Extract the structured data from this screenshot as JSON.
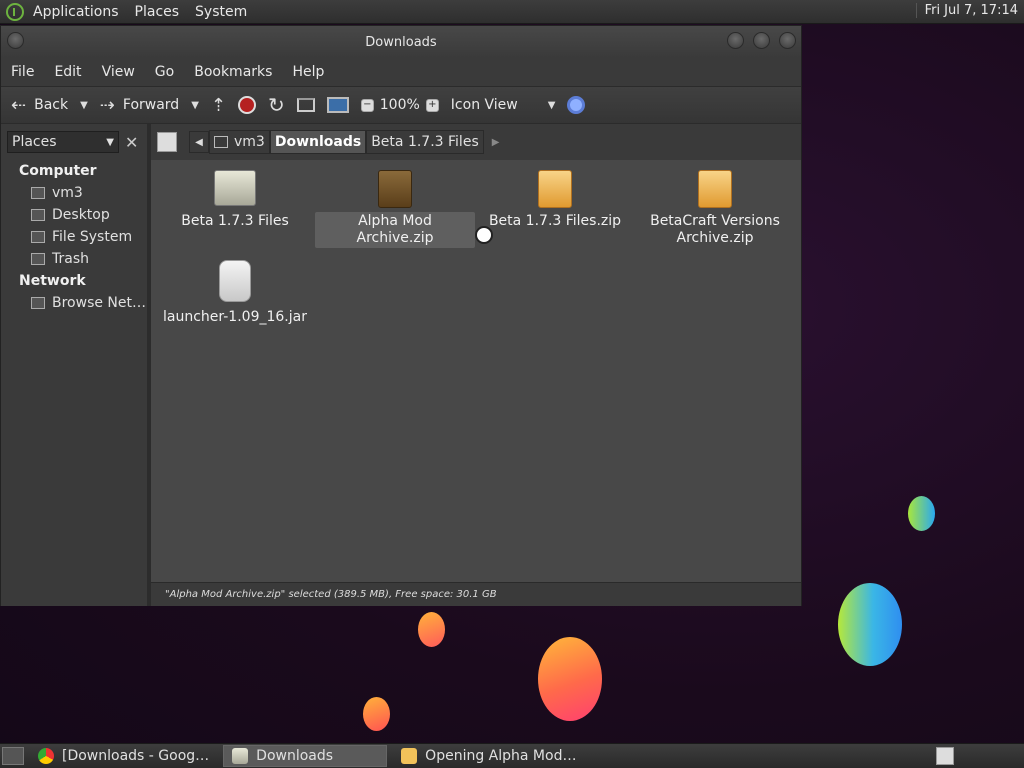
{
  "top_panel": {
    "menus": [
      "Applications",
      "Places",
      "System"
    ],
    "clock": "Fri Jul 7, 17:14"
  },
  "window": {
    "title": "Downloads",
    "menu": [
      "File",
      "Edit",
      "View",
      "Go",
      "Bookmarks",
      "Help"
    ],
    "toolbar": {
      "back_label": "Back",
      "forward_label": "Forward",
      "zoom": "100%",
      "view_mode": "Icon View"
    },
    "sidebar": {
      "selector": "Places",
      "sections": [
        {
          "title": "Computer",
          "items": [
            "vm3",
            "Desktop",
            "File System",
            "Trash"
          ]
        },
        {
          "title": "Network",
          "items": [
            "Browse Net…"
          ]
        }
      ]
    },
    "pathbar": {
      "crumbs": [
        "vm3",
        "Downloads",
        "Beta 1.7.3 Files"
      ]
    },
    "files": [
      {
        "name": "Beta 1.7.3 Files",
        "type": "folder"
      },
      {
        "name": "Alpha Mod Archive.zip",
        "type": "zip-dark",
        "selected": true
      },
      {
        "name": "Beta 1.7.3 Files.zip",
        "type": "zip"
      },
      {
        "name": "BetaCraft Versions Archive.zip",
        "type": "zip"
      },
      {
        "name": "launcher-1.09_16.jar",
        "type": "jar"
      }
    ],
    "status": "\"Alpha Mod Archive.zip\" selected (389.5 MB), Free space: 30.1 GB"
  },
  "taskbar": {
    "tasks": [
      {
        "label": "[Downloads - Goog…",
        "icon": "chrome-icon"
      },
      {
        "label": "Downloads",
        "icon": "folder-icon",
        "active": true
      },
      {
        "label": "Opening Alpha Mod…",
        "icon": "document-icon"
      }
    ]
  }
}
